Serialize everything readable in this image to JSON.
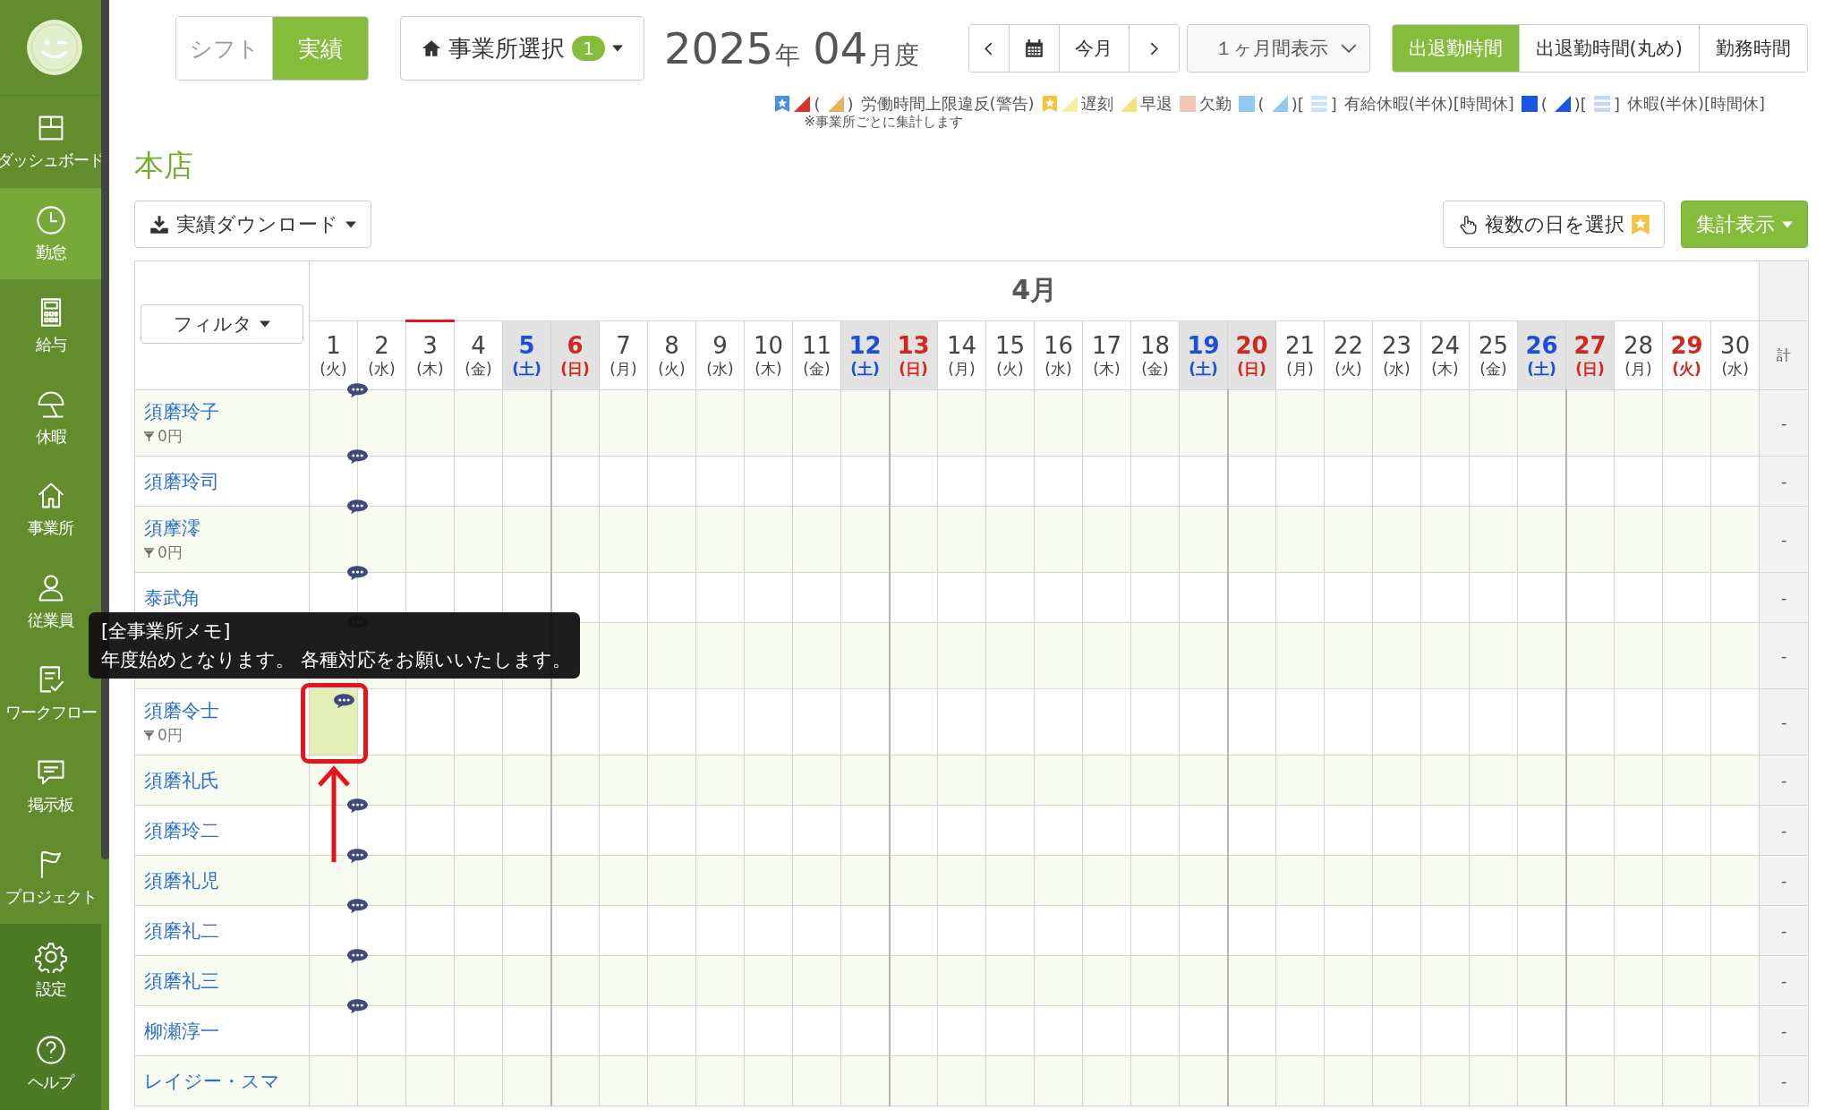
{
  "sidebar": {
    "items": [
      {
        "label": "ダッシュボード",
        "kind": "dashboard",
        "selected": false
      },
      {
        "label": "勤怠",
        "kind": "clock",
        "selected": true
      },
      {
        "label": "給与",
        "kind": "calculator",
        "selected": false
      },
      {
        "label": "休暇",
        "kind": "umbrella",
        "selected": false
      },
      {
        "label": "事業所",
        "kind": "house",
        "selected": false
      },
      {
        "label": "従業員",
        "kind": "person",
        "selected": false
      },
      {
        "label": "ワークフロー",
        "kind": "checklist",
        "selected": false
      },
      {
        "label": "掲示板",
        "kind": "chat",
        "selected": false
      },
      {
        "label": "プロジェクト",
        "kind": "flag",
        "selected": false
      }
    ],
    "bottom_items": [
      {
        "label": "設定",
        "kind": "gear"
      },
      {
        "label": "ヘルプ",
        "kind": "help"
      }
    ]
  },
  "header": {
    "mode_tabs": [
      {
        "label": "シフト",
        "selected": false
      },
      {
        "label": "実績",
        "selected": true
      }
    ],
    "office_select": {
      "label": "事業所選択",
      "badge": "1"
    },
    "period": {
      "year": "2025",
      "year_unit": "年",
      "month": "04",
      "month_unit": "月度"
    },
    "nav": {
      "current": "今月"
    },
    "range_select": {
      "value": "１ヶ月間表示"
    },
    "time_tabs": [
      {
        "label": "出退勤時間",
        "selected": true
      },
      {
        "label": "出退勤時間(丸め)",
        "selected": false
      },
      {
        "label": "勤務時間",
        "selected": false
      }
    ]
  },
  "legend": {
    "parts": [
      {
        "kind": "badge",
        "color": "#4a90e2"
      },
      {
        "kind": "triangle",
        "color": "#d9342b"
      },
      {
        "kind": "text",
        "text": "("
      },
      {
        "kind": "triangle",
        "color": "#eab25e"
      },
      {
        "kind": "text",
        "text": ")"
      },
      {
        "kind": "text",
        "text": "労働時間上限違反(警告)"
      },
      {
        "kind": "badge",
        "color": "#f5c242"
      },
      {
        "kind": "triangle",
        "color": "#f7efa0"
      },
      {
        "kind": "text",
        "text": "遅刻"
      },
      {
        "kind": "triangle",
        "color": "#f2e47a"
      },
      {
        "kind": "text",
        "text": "早退"
      },
      {
        "kind": "block",
        "color": "#f2c6b6"
      },
      {
        "kind": "text",
        "text": "欠勤"
      },
      {
        "kind": "block",
        "color": "#8fcaf5"
      },
      {
        "kind": "text",
        "text": "("
      },
      {
        "kind": "triangle",
        "color": "#8fcaf5"
      },
      {
        "kind": "text",
        "text": ")["
      },
      {
        "kind": "stripes",
        "color": "#c9e2fa"
      },
      {
        "kind": "text",
        "text": "]"
      },
      {
        "kind": "text",
        "text": "有給休暇(半休)[時間休]"
      },
      {
        "kind": "block",
        "color": "#1a55e8"
      },
      {
        "kind": "text",
        "text": "("
      },
      {
        "kind": "triangle",
        "color": "#1a55e8"
      },
      {
        "kind": "text",
        "text": ")["
      },
      {
        "kind": "stripes",
        "color": "#c3d6f7"
      },
      {
        "kind": "text",
        "text": "]"
      },
      {
        "kind": "text",
        "text": "休暇(半休)[時間休]"
      }
    ],
    "note": "※事業所ごとに集計します"
  },
  "office_title": "本店",
  "toolbar": {
    "download": "実績ダウンロード",
    "multi_select": "複数の日を選択",
    "summary": "集計表示"
  },
  "table": {
    "filter": "フィルタ",
    "month": "4月",
    "total_header": "計",
    "days": [
      {
        "day": "1",
        "weekday": "(火)",
        "kind": "weekday",
        "today": false
      },
      {
        "day": "2",
        "weekday": "(水)",
        "kind": "weekday",
        "today": false
      },
      {
        "day": "3",
        "weekday": "(木)",
        "kind": "weekday",
        "today": true
      },
      {
        "day": "4",
        "weekday": "(金)",
        "kind": "weekday",
        "today": false
      },
      {
        "day": "5",
        "weekday": "(土)",
        "kind": "saturday",
        "today": false
      },
      {
        "day": "6",
        "weekday": "(日)",
        "kind": "sunday",
        "today": false
      },
      {
        "day": "7",
        "weekday": "(月)",
        "kind": "weekday",
        "today": false
      },
      {
        "day": "8",
        "weekday": "(火)",
        "kind": "weekday",
        "today": false
      },
      {
        "day": "9",
        "weekday": "(水)",
        "kind": "weekday",
        "today": false
      },
      {
        "day": "10",
        "weekday": "(木)",
        "kind": "weekday",
        "today": false
      },
      {
        "day": "11",
        "weekday": "(金)",
        "kind": "weekday",
        "today": false
      },
      {
        "day": "12",
        "weekday": "(土)",
        "kind": "saturday",
        "today": false
      },
      {
        "day": "13",
        "weekday": "(日)",
        "kind": "sunday",
        "today": false
      },
      {
        "day": "14",
        "weekday": "(月)",
        "kind": "weekday",
        "today": false
      },
      {
        "day": "15",
        "weekday": "(火)",
        "kind": "weekday",
        "today": false
      },
      {
        "day": "16",
        "weekday": "(水)",
        "kind": "weekday",
        "today": false
      },
      {
        "day": "17",
        "weekday": "(木)",
        "kind": "weekday",
        "today": false
      },
      {
        "day": "18",
        "weekday": "(金)",
        "kind": "weekday",
        "today": false
      },
      {
        "day": "19",
        "weekday": "(土)",
        "kind": "saturday",
        "today": false
      },
      {
        "day": "20",
        "weekday": "(日)",
        "kind": "sunday",
        "today": false
      },
      {
        "day": "21",
        "weekday": "(月)",
        "kind": "weekday",
        "today": false
      },
      {
        "day": "22",
        "weekday": "(火)",
        "kind": "weekday",
        "today": false
      },
      {
        "day": "23",
        "weekday": "(水)",
        "kind": "weekday",
        "today": false
      },
      {
        "day": "24",
        "weekday": "(木)",
        "kind": "weekday",
        "today": false
      },
      {
        "day": "25",
        "weekday": "(金)",
        "kind": "weekday",
        "today": false
      },
      {
        "day": "26",
        "weekday": "(土)",
        "kind": "saturday",
        "today": false
      },
      {
        "day": "27",
        "weekday": "(日)",
        "kind": "sunday",
        "today": false
      },
      {
        "day": "28",
        "weekday": "(月)",
        "kind": "weekday",
        "today": false
      },
      {
        "day": "29",
        "weekday": "(火)",
        "kind": "holiday",
        "today": false
      },
      {
        "day": "30",
        "weekday": "(水)",
        "kind": "weekday",
        "today": false
      }
    ],
    "rows": [
      {
        "name": "須磨玲子",
        "wage": "0円",
        "memo": true,
        "marked": false,
        "total": "-"
      },
      {
        "name": "須磨玲司",
        "memo": true,
        "marked": false,
        "total": "-"
      },
      {
        "name": "須摩澪",
        "wage": "0円",
        "memo": true,
        "marked": false,
        "total": "-"
      },
      {
        "name": "泰武角",
        "memo": true,
        "marked": false,
        "total": "-"
      },
      {
        "tall": true,
        "memo": true,
        "marked": false,
        "total": "-"
      },
      {
        "name": "須磨令士",
        "wage": "0円",
        "memo": true,
        "marked": true,
        "total": "-"
      },
      {
        "name": "須磨礼氏",
        "memo": false,
        "marked": false,
        "total": "-"
      },
      {
        "name": "須磨玲二",
        "memo": true,
        "marked": false,
        "total": "-"
      },
      {
        "name": "須磨礼児",
        "memo": true,
        "marked": false,
        "total": "-"
      },
      {
        "name": "須磨礼二",
        "memo": true,
        "marked": false,
        "total": "-"
      },
      {
        "name": "須磨礼三",
        "memo": true,
        "marked": false,
        "total": "-"
      },
      {
        "name": "柳瀬淳一",
        "memo": true,
        "marked": false,
        "total": "-"
      },
      {
        "name": "レイジー・スマ",
        "memo": false,
        "marked": false,
        "total": "-"
      }
    ]
  },
  "tooltip": {
    "title": "[全事業所メモ]",
    "text": "年度始めとなります。 各種対応をお願いいたします。"
  }
}
